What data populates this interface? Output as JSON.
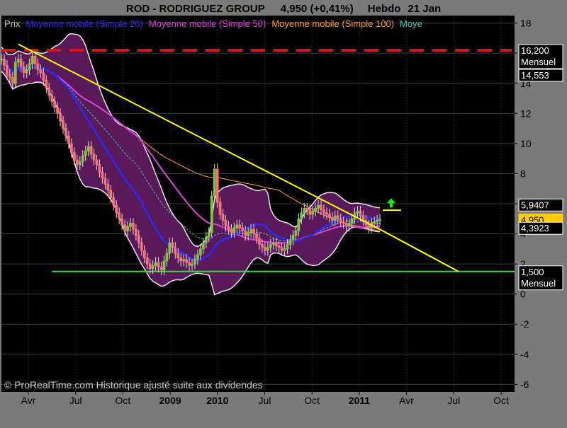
{
  "header": {
    "ticker_name": "ROD - RODRIGUEZ GROUP",
    "price_change": "4,950 (+0,41%)",
    "period": "Hebdo",
    "date": "21 Jan"
  },
  "legend": {
    "items": [
      {
        "label": "Prix",
        "color": "#c8c8c8"
      },
      {
        "label": "Moyenne mobile (Simple 20)",
        "color": "#2a2aff"
      },
      {
        "label": "Moyenne mobile (Simple 50)",
        "color": "#e040e0"
      },
      {
        "label": "Moyenne mobile (Simple 100)",
        "color": "#ff9a30"
      },
      {
        "label": "Moye",
        "color": "#40c8c8"
      }
    ]
  },
  "footer": {
    "copyright": "© ProRealTime.com Historique ajusté suite aux dividendes"
  },
  "price_tags": [
    {
      "value": "16,200",
      "sub": "Mensuel",
      "bg": "#000000",
      "fg": "#ffffff",
      "border": "#ffffff"
    },
    {
      "value": "14,553",
      "sub": "",
      "bg": "#000000",
      "fg": "#ffffff",
      "border": "#ffffff"
    },
    {
      "value": "5,9407",
      "sub": "",
      "bg": "#000000",
      "fg": "#ffffff",
      "border": "#ffffff"
    },
    {
      "value": "4,950",
      "sub": "",
      "bg": "#ffcc00",
      "fg": "#000000",
      "border": "#ffcc00"
    },
    {
      "value": "4,3923",
      "sub": "",
      "bg": "#000000",
      "fg": "#ffffff",
      "border": "#ffffff"
    },
    {
      "value": "1,500",
      "sub": "Mensuel",
      "bg": "#000000",
      "fg": "#ffffff",
      "border": "#ffffff"
    }
  ],
  "chart_data": {
    "type": "line",
    "x_ticks": [
      "Avr",
      "Jul",
      "Oct",
      "2009",
      "2010",
      "Jul",
      "Oct",
      "2011",
      "Avr",
      "Jul",
      "Oct"
    ],
    "bold_ticks": [
      "2009",
      "2010",
      "2011"
    ],
    "y_ticks": [
      18,
      16,
      14,
      12,
      10,
      8,
      6,
      4,
      2,
      0,
      -2,
      -4,
      -6
    ],
    "ylim": [
      -6.5,
      18.5
    ],
    "grid": true,
    "colors": {
      "background": "#000000",
      "band_fill": "#5a1a5a",
      "band_edge": "#e8e8e8",
      "candle_up": "#7ec83c",
      "candle_down": "#ff7070",
      "sma20": "#2a2aff",
      "sma50": "#e040e0",
      "sma100": "#ff9a30",
      "cyan": "#40c8c8",
      "trendline": "#ffff00",
      "resistance": "#dd1111",
      "support": "#33dd33",
      "arrow": "#00ff00"
    },
    "horizontal_levels": [
      {
        "name": "resistance",
        "value": 16.2,
        "style": "dashed"
      },
      {
        "name": "support",
        "value": 1.5,
        "style": "solid"
      }
    ],
    "x_index_range": [
      0,
      183
    ],
    "last_index": 136,
    "weekly_closes": [
      15.6,
      15.2,
      14.6,
      14.4,
      14.0,
      15.4,
      15.6,
      15.1,
      14.7,
      14.9,
      15.3,
      15.8,
      15.3,
      14.9,
      14.7,
      14.2,
      13.7,
      13.2,
      12.8,
      12.4,
      12.0,
      11.5,
      11.0,
      10.5,
      10.0,
      9.4,
      8.9,
      8.6,
      8.8,
      9.2,
      9.5,
      9.8,
      9.3,
      8.9,
      8.6,
      8.1,
      7.7,
      7.3,
      6.9,
      6.4,
      5.9,
      5.4,
      5.0,
      4.6,
      4.2,
      4.5,
      4.7,
      4.3,
      3.9,
      3.4,
      2.9,
      2.4,
      2.0,
      1.7,
      1.9,
      2.1,
      1.8,
      1.6,
      2.2,
      2.7,
      3.4,
      3.1,
      2.7,
      2.4,
      2.2,
      2.3,
      2.1,
      1.9,
      2.0,
      2.3,
      2.6,
      3.0,
      3.4,
      3.8,
      4.1,
      6.5,
      8.3,
      6.1,
      5.3,
      4.9,
      4.5,
      4.3,
      4.1,
      4.4,
      4.6,
      4.4,
      4.2,
      3.9,
      4.1,
      4.3,
      4.0,
      3.7,
      3.3,
      3.1,
      2.9,
      3.1,
      3.3,
      3.4,
      3.2,
      3.1,
      2.9,
      3.0,
      3.3,
      3.6,
      3.9,
      4.2,
      5.0,
      5.4,
      5.7,
      5.6,
      5.3,
      5.5,
      5.7,
      5.9,
      5.6,
      5.4,
      5.3,
      5.1,
      4.9,
      5.2,
      5.0,
      4.8,
      4.7,
      4.5,
      4.7,
      5.0,
      5.4,
      5.5,
      5.2,
      4.9,
      4.6,
      4.4,
      4.7,
      4.8,
      4.9,
      4.95
    ],
    "trendline": [
      {
        "x": 6,
        "y": 16.6
      },
      {
        "x": 136,
        "y": 4.2
      },
      {
        "x": 163,
        "y": 1.5
      }
    ]
  }
}
